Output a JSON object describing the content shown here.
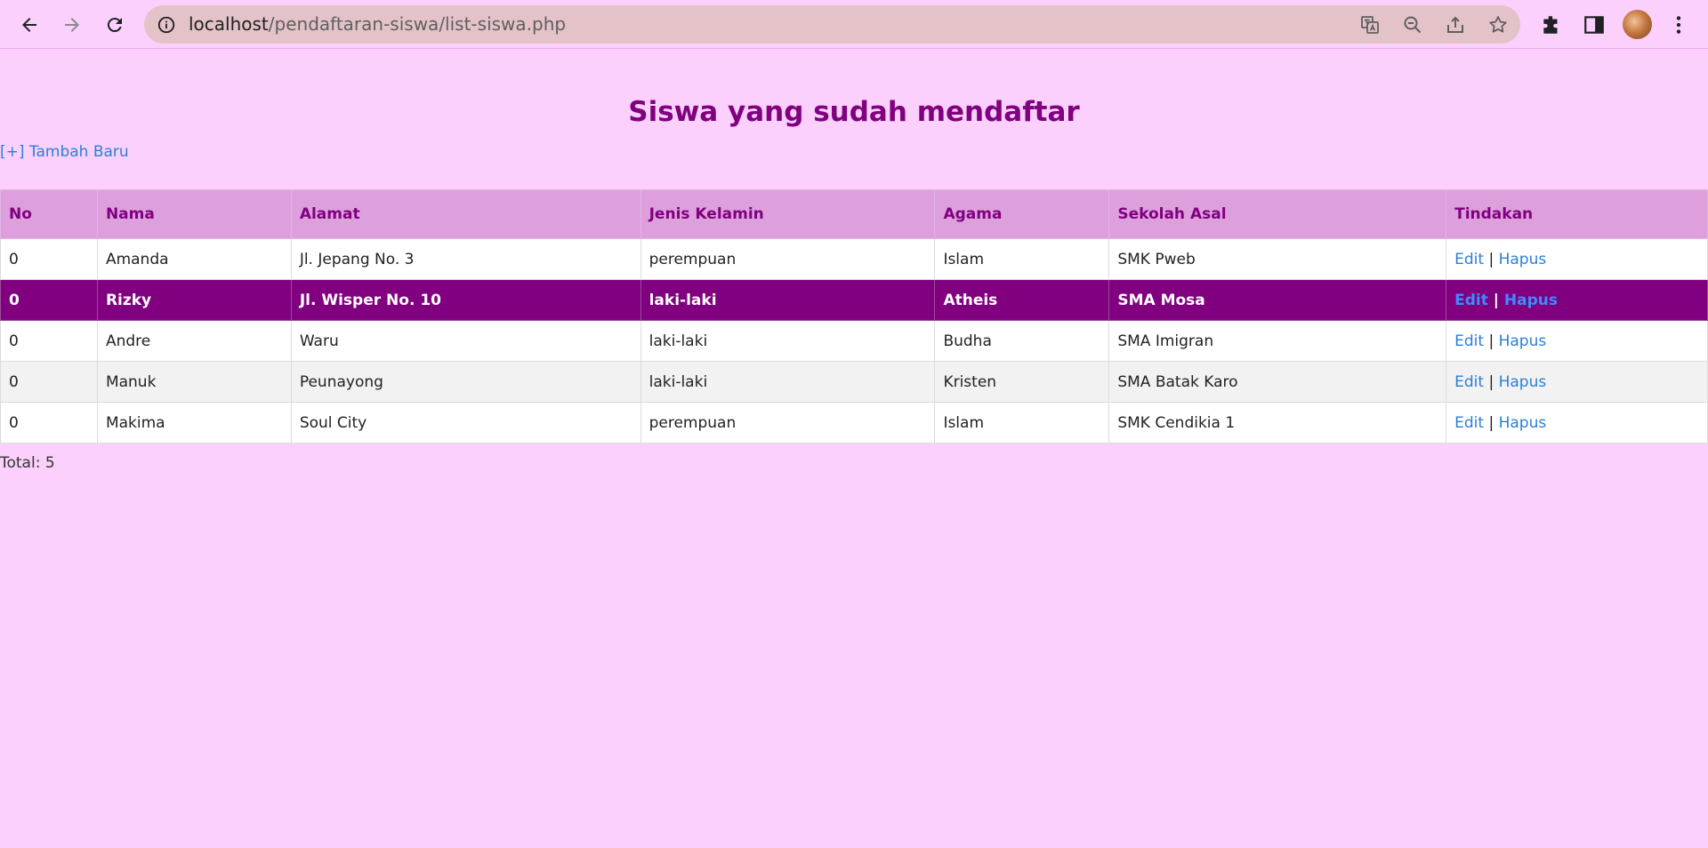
{
  "browser": {
    "url_host": "localhost",
    "url_path": "/pendaftaran-siswa/list-siswa.php"
  },
  "page": {
    "title": "Siswa yang sudah mendaftar",
    "add_link": "[+] Tambah Baru",
    "total": "Total: 5"
  },
  "table": {
    "headers": [
      "No",
      "Nama",
      "Alamat",
      "Jenis Kelamin",
      "Agama",
      "Sekolah Asal",
      "Tindakan"
    ],
    "rows": [
      {
        "no": "0",
        "nama": "Amanda",
        "alamat": "Jl. Jepang No. 3",
        "jk": "perempuan",
        "agama": "Islam",
        "sekolah": "SMK Pweb",
        "edit": "Edit",
        "sep": "|",
        "hapus": "Hapus"
      },
      {
        "no": "0",
        "nama": "Rizky",
        "alamat": "Jl. Wisper No. 10",
        "jk": "laki-laki",
        "agama": "Atheis",
        "sekolah": "SMA Mosa",
        "edit": "Edit",
        "sep": "|",
        "hapus": "Hapus"
      },
      {
        "no": "0",
        "nama": "Andre",
        "alamat": "Waru",
        "jk": "laki-laki",
        "agama": "Budha",
        "sekolah": "SMA Imigran",
        "edit": "Edit",
        "sep": "|",
        "hapus": "Hapus"
      },
      {
        "no": "0",
        "nama": "Manuk",
        "alamat": "Peunayong",
        "jk": "laki-laki",
        "agama": "Kristen",
        "sekolah": "SMA Batak Karo",
        "edit": "Edit",
        "sep": "|",
        "hapus": "Hapus"
      },
      {
        "no": "0",
        "nama": "Makima",
        "alamat": "Soul City",
        "jk": "perempuan",
        "agama": "Islam",
        "sekolah": "SMK Cendikia 1",
        "edit": "Edit",
        "sep": "|",
        "hapus": "Hapus"
      }
    ]
  },
  "colors": {
    "page_background": "#fbd0fd",
    "header_background": "#dda0dd",
    "accent": "#800080",
    "link": "#2a7fd8"
  },
  "icons": [
    "back-arrow-icon",
    "forward-arrow-icon",
    "reload-icon",
    "site-info-icon",
    "translate-icon",
    "zoom-out-icon",
    "share-icon",
    "bookmark-star-icon",
    "extensions-puzzle-icon",
    "side-panel-icon",
    "profile-avatar",
    "kebab-menu-icon"
  ]
}
